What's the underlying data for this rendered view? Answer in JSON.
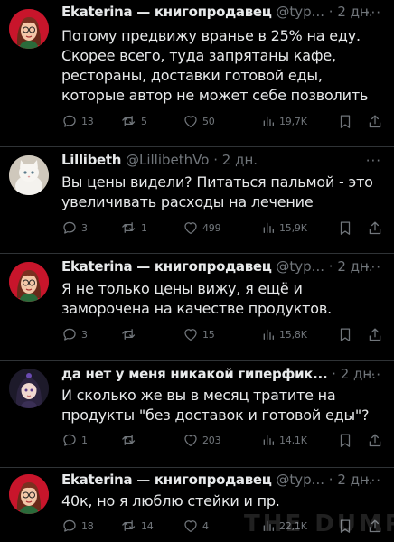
{
  "tweets": [
    {
      "name": "Ekaterina — книгопродавец",
      "handle": "@typ...",
      "sep": "·",
      "time": "2 дн.",
      "more": "···",
      "text": "Потому предвижу вранье в 25% на еду. Скорее всего, туда запрятаны кафе, рестораны, доставки готовой еды, которые автор не может себе позволить",
      "replies": "13",
      "retweets": "5",
      "likes": "50",
      "views": "19,7K"
    },
    {
      "name": "Lillibeth",
      "handle": "@LillibethVo",
      "sep": "·",
      "time": "2 дн.",
      "more": "···",
      "text": "Вы цены видели? Питаться пальмой - это увеличивать расходы на лечение",
      "replies": "3",
      "retweets": "1",
      "likes": "499",
      "views": "15,9K"
    },
    {
      "name": "Ekaterina — книгопродавец",
      "handle": "@typ...",
      "sep": "·",
      "time": "2 дн.",
      "more": "···",
      "text": "Я не только цены вижу, я ещё и заморочена на качестве продуктов.",
      "replies": "3",
      "retweets": "",
      "likes": "15",
      "views": "15,8K"
    },
    {
      "name": "да нет у меня никакой гиперфик...",
      "handle": "",
      "sep": "·",
      "time": "2 дн.",
      "more": "···",
      "text": "И сколько же вы в месяц тратите на продукты \"без доставок и готовой еды\"?",
      "replies": "1",
      "retweets": "",
      "likes": "203",
      "views": "14,1K"
    },
    {
      "name": "Ekaterina — книгопродавец",
      "handle": "@typ...",
      "sep": "·",
      "time": "2 дн.",
      "more": "···",
      "text": "40к, но я люблю стейки и пр.",
      "replies": "18",
      "retweets": "14",
      "likes": "4",
      "views": "22,1K"
    }
  ],
  "watermark": "THE DUMP",
  "colors": {
    "background": "#000000",
    "text": "#e7e9ea",
    "secondary": "#71767b",
    "divider": "#2f3336"
  }
}
